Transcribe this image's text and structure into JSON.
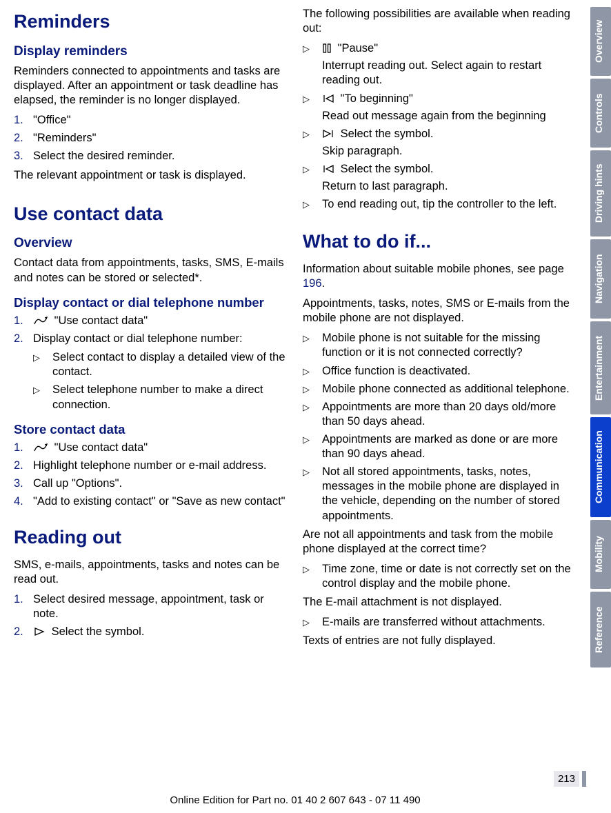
{
  "left": {
    "h_reminders": "Reminders",
    "h_display_reminders": "Display reminders",
    "p_reminders_intro": "Reminders connected to appointments and tasks are displayed. After an appointment or task deadline has elapsed, the reminder is no longer displayed.",
    "rem_steps": {
      "s1": "\"Office\"",
      "s2": "\"Reminders\"",
      "s3": "Select the desired reminder."
    },
    "p_reminders_out": "The relevant appointment or task is displayed.",
    "h_use_contact": "Use contact data",
    "h_overview": "Overview",
    "p_overview": "Contact data from appointments, tasks, SMS, E-mails and notes can be stored or selected*.",
    "h_display_contact": "Display contact or dial telephone number",
    "dc_steps": {
      "s1": "\"Use contact data\"",
      "s2": "Display contact or dial telephone number:"
    },
    "dc_sub": {
      "a": "Select contact to display a detailed view of the contact.",
      "b": "Select telephone number to make a direct connection."
    },
    "h_store": "Store contact data",
    "store_steps": {
      "s1": "\"Use contact data\"",
      "s2": "Highlight telephone number or e-mail address.",
      "s3": "Call up \"Options\".",
      "s4": "\"Add to existing contact\" or \"Save as new contact\""
    },
    "h_reading": "Reading out",
    "p_reading_intro": "SMS, e-mails, appointments, tasks and notes can be read out.",
    "read_steps": {
      "s1": "Select desired message, appointment, task or note.",
      "s2": "Select the symbol."
    }
  },
  "right": {
    "p_following": "The following possibilities are available when reading out:",
    "opts": {
      "pause_label": "\"Pause\"",
      "pause_desc": "Interrupt reading out. Select again to restart reading out.",
      "begin_label": "\"To beginning\"",
      "begin_desc": "Read out message again from the beginning",
      "skip_label": "Select the symbol.",
      "skip_desc": "Skip paragraph.",
      "return_label": "Select the symbol.",
      "return_desc": "Return to last paragraph.",
      "end": "To end reading out, tip the controller to the left."
    },
    "h_what": "What to do if...",
    "p_info_a": "Information about suitable mobile phones, see page ",
    "p_info_link": "196",
    "p_info_b": ".",
    "p_not_displayed": "Appointments, tasks, notes, SMS or E-mails from the mobile phone are not displayed.",
    "causes": {
      "c1": "Mobile phone is not suitable for the missing function or it is not connected correctly?",
      "c2": "Office function is deactivated.",
      "c3": "Mobile phone connected as additional telephone.",
      "c4": "Appointments are more than 20 days old/more than 50 days ahead.",
      "c5": "Appointments are marked as done or are more than 90 days ahead.",
      "c6": "Not all stored appointments, tasks, notes, messages in the mobile phone are displayed in the vehicle, depending on the number of stored appointments."
    },
    "p_time_q": "Are not all appointments and task from the mobile phone displayed at the correct time?",
    "time_cause": "Time zone, time or date is not correctly set on the control display and the mobile phone.",
    "p_attach": "The E-mail attachment is not displayed.",
    "attach_cause": "E-mails are transferred without attachments.",
    "p_texts": "Texts of entries are not fully displayed."
  },
  "tabs": {
    "t1": "Overview",
    "t2": "Controls",
    "t3": "Driving hints",
    "t4": "Navigation",
    "t5": "Entertainment",
    "t6": "Communication",
    "t7": "Mobility",
    "t8": "Reference"
  },
  "page_number": "213",
  "footer": "Online Edition for Part no. 01 40 2 607 643 - 07 11 490"
}
